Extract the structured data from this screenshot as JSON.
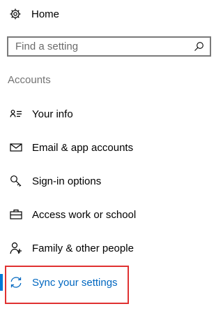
{
  "home": {
    "label": "Home",
    "icon": "gear-icon"
  },
  "search": {
    "placeholder": "Find a setting",
    "value": "",
    "icon": "search-icon"
  },
  "section": {
    "title": "Accounts"
  },
  "nav": {
    "items": [
      {
        "label": "Your info",
        "icon": "contact-card-icon"
      },
      {
        "label": "Email & app accounts",
        "icon": "envelope-icon"
      },
      {
        "label": "Sign-in options",
        "icon": "key-icon"
      },
      {
        "label": "Access work or school",
        "icon": "briefcase-icon"
      },
      {
        "label": "Family & other people",
        "icon": "person-add-icon"
      },
      {
        "label": "Sync your settings",
        "icon": "sync-icon",
        "active": true
      }
    ]
  },
  "colors": {
    "accent": "#0078d7",
    "active_text": "#0067c0",
    "highlight_border": "#e03131",
    "section_title": "#737373"
  }
}
